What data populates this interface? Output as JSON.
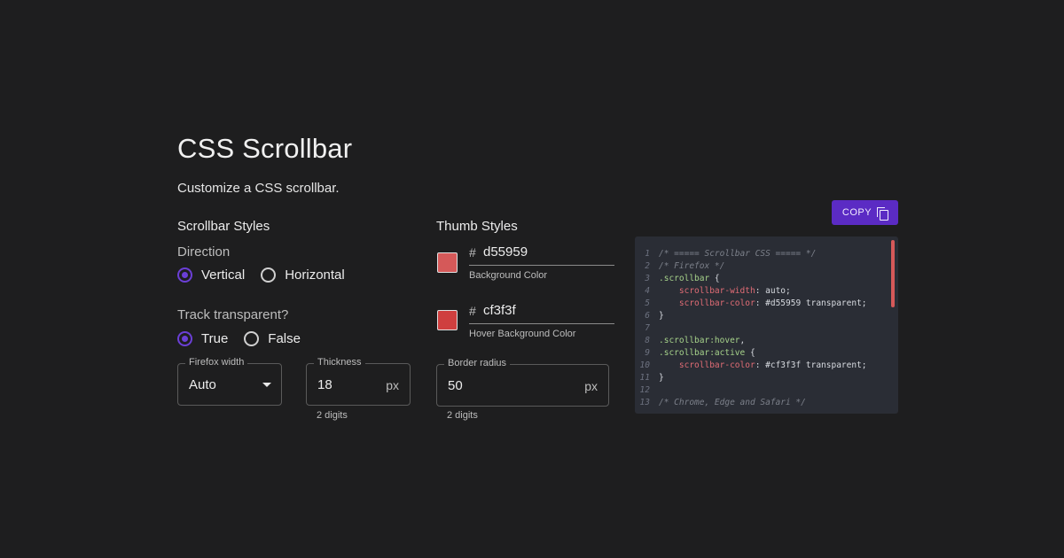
{
  "page": {
    "title": "CSS Scrollbar",
    "subtitle": "Customize a CSS scrollbar."
  },
  "scrollbar_styles": {
    "heading": "Scrollbar Styles",
    "direction_label": "Direction",
    "direction_options": [
      {
        "label": "Vertical",
        "checked": true
      },
      {
        "label": "Horizontal",
        "checked": false
      }
    ],
    "track_label": "Track transparent?",
    "track_options": [
      {
        "label": "True",
        "checked": true
      },
      {
        "label": "False",
        "checked": false
      }
    ],
    "firefox_width": {
      "legend": "Firefox width",
      "value": "Auto"
    },
    "thickness": {
      "legend": "Thickness",
      "value": "18",
      "suffix": "px",
      "helper": "2 digits"
    }
  },
  "thumb_styles": {
    "heading": "Thumb Styles",
    "background": {
      "hash": "#",
      "value": "d55959",
      "helper": "Background Color",
      "color": "#d55959"
    },
    "hover": {
      "hash": "#",
      "value": "cf3f3f",
      "helper": "Hover Background Color",
      "color": "#cf3f3f"
    },
    "border_radius": {
      "legend": "Border radius",
      "value": "50",
      "suffix": "px",
      "helper": "2 digits"
    }
  },
  "copy_button": {
    "label": "COPY",
    "icon": "copy-icon"
  },
  "colors": {
    "accent": "#5b2bc4",
    "background": "#1e1e1f",
    "code_bg": "#2a2d35"
  },
  "code": [
    {
      "n": "1",
      "tokens": [
        {
          "t": "comment",
          "v": "/* ===== Scrollbar CSS ===== */"
        }
      ]
    },
    {
      "n": "2",
      "tokens": [
        {
          "t": "comment",
          "v": "/* Firefox */"
        }
      ]
    },
    {
      "n": "3",
      "tokens": [
        {
          "t": "sel",
          "v": ".scrollbar"
        },
        {
          "t": "plain",
          "v": " {"
        }
      ]
    },
    {
      "n": "4",
      "tokens": [
        {
          "t": "plain",
          "v": "    "
        },
        {
          "t": "prop",
          "v": "scrollbar-width"
        },
        {
          "t": "plain",
          "v": ": auto;"
        }
      ]
    },
    {
      "n": "5",
      "tokens": [
        {
          "t": "plain",
          "v": "    "
        },
        {
          "t": "prop",
          "v": "scrollbar-color"
        },
        {
          "t": "plain",
          "v": ": #d55959 transparent;"
        }
      ]
    },
    {
      "n": "6",
      "tokens": [
        {
          "t": "plain",
          "v": "}"
        }
      ]
    },
    {
      "n": "7",
      "tokens": []
    },
    {
      "n": "8",
      "tokens": [
        {
          "t": "sel",
          "v": ".scrollbar:hover"
        },
        {
          "t": "plain",
          "v": ","
        }
      ]
    },
    {
      "n": "9",
      "tokens": [
        {
          "t": "sel",
          "v": ".scrollbar:active"
        },
        {
          "t": "plain",
          "v": " {"
        }
      ]
    },
    {
      "n": "10",
      "tokens": [
        {
          "t": "plain",
          "v": "    "
        },
        {
          "t": "prop",
          "v": "scrollbar-color"
        },
        {
          "t": "plain",
          "v": ": #cf3f3f transparent;"
        }
      ]
    },
    {
      "n": "11",
      "tokens": [
        {
          "t": "plain",
          "v": "}"
        }
      ]
    },
    {
      "n": "12",
      "tokens": []
    },
    {
      "n": "13",
      "tokens": [
        {
          "t": "comment",
          "v": "/* Chrome, Edge and Safari */"
        }
      ]
    }
  ]
}
